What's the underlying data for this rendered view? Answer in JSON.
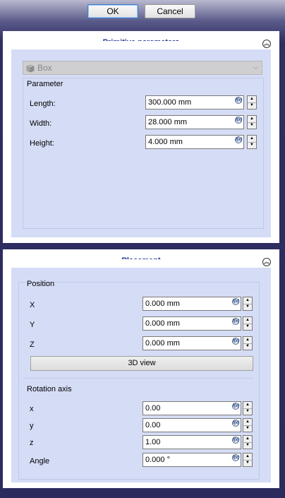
{
  "dialog": {
    "ok_label": "OK",
    "cancel_label": "Cancel"
  },
  "primitive_panel": {
    "title": "Primitive parameters",
    "type_combo": {
      "selected": "Box"
    },
    "group_label": "Parameter",
    "fields": [
      {
        "label": "Length:",
        "value": "300.000 mm"
      },
      {
        "label": "Width:",
        "value": "28.000 mm"
      },
      {
        "label": "Height:",
        "value": "4.000 mm"
      }
    ]
  },
  "placement_panel": {
    "title": "Placement",
    "position_label": "Position",
    "position_fields": [
      {
        "label": "X",
        "value": "0.000 mm"
      },
      {
        "label": "Y",
        "value": "0.000 mm"
      },
      {
        "label": "Z",
        "value": "0.000 mm"
      }
    ],
    "view_button_label": "3D view",
    "rotation_label": "Rotation axis",
    "rotation_fields": [
      {
        "label": "x",
        "value": "0.00"
      },
      {
        "label": "y",
        "value": "0.00"
      },
      {
        "label": "z",
        "value": "1.00"
      },
      {
        "label": "Angle",
        "value": "0.000 °"
      }
    ]
  },
  "icons": {
    "expression": "fx-expression-icon",
    "collapse": "collapse-chevrons-icon",
    "box": "box-cube-icon",
    "dropdown": "chevron-down-icon"
  }
}
